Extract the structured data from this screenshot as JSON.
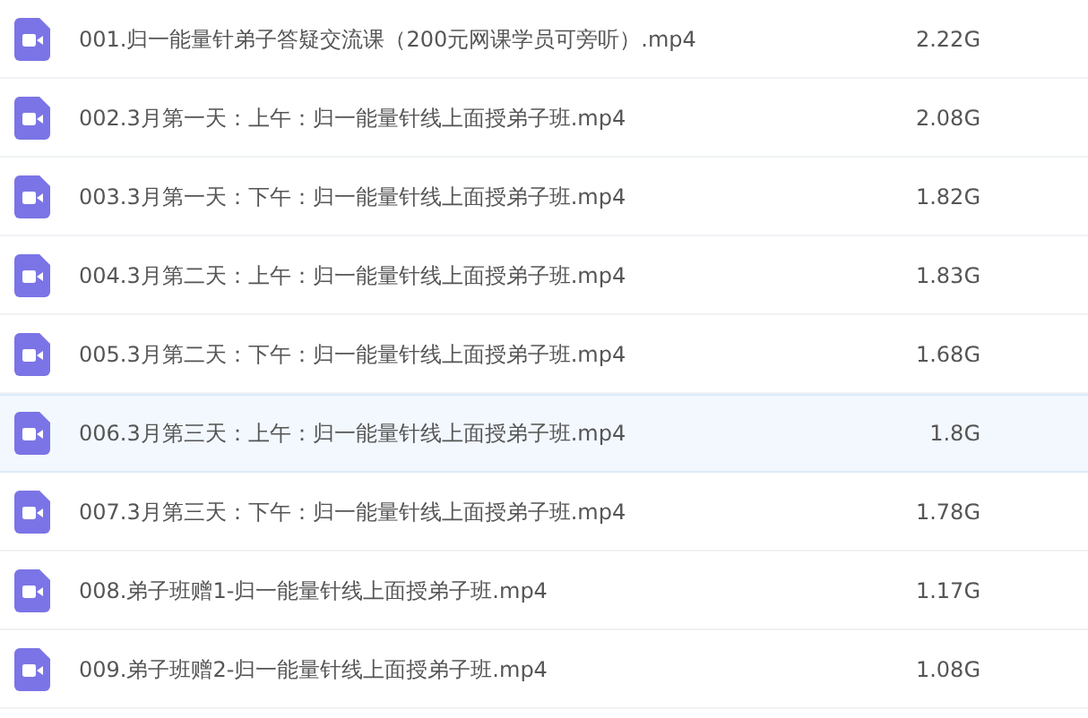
{
  "files": [
    {
      "name": "001.归一能量针弟子答疑交流课（200元网课学员可旁听）.mp4",
      "size": "2.22G",
      "selected": false
    },
    {
      "name": "002.3月第一天：上午：归一能量针线上面授弟子班.mp4",
      "size": "2.08G",
      "selected": false
    },
    {
      "name": "003.3月第一天：下午：归一能量针线上面授弟子班.mp4",
      "size": "1.82G",
      "selected": false
    },
    {
      "name": "004.3月第二天：上午：归一能量针线上面授弟子班.mp4",
      "size": "1.83G",
      "selected": false
    },
    {
      "name": "005.3月第二天：下午：归一能量针线上面授弟子班.mp4",
      "size": "1.68G",
      "selected": false
    },
    {
      "name": "006.3月第三天：上午：归一能量针线上面授弟子班.mp4",
      "size": "1.8G",
      "selected": true
    },
    {
      "name": "007.3月第三天：下午：归一能量针线上面授弟子班.mp4",
      "size": "1.78G",
      "selected": false
    },
    {
      "name": "008.弟子班赠1-归一能量针线上面授弟子班.mp4",
      "size": "1.17G",
      "selected": false
    },
    {
      "name": "009.弟子班赠2-归一能量针线上面授弟子班.mp4",
      "size": "1.08G",
      "selected": false
    }
  ]
}
